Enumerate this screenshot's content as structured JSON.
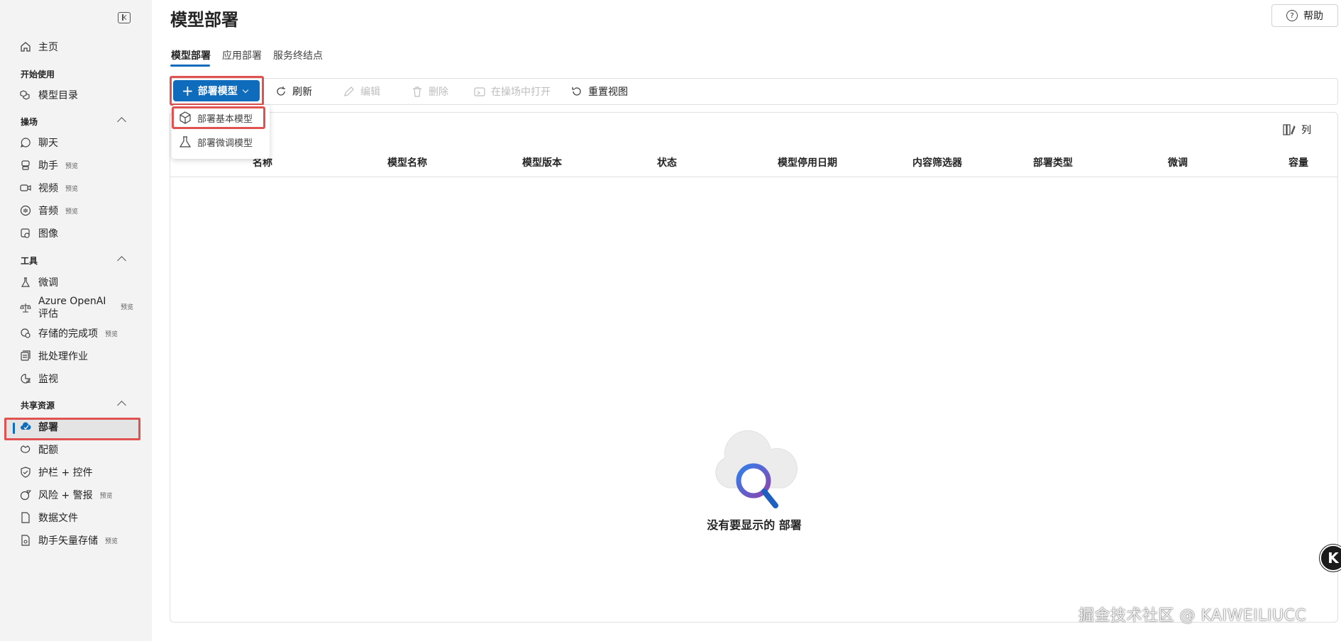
{
  "sidebar": {
    "home": "主页",
    "sections": {
      "get_started": "开始使用",
      "playground": "操场",
      "tools": "工具",
      "shared": "共享资源"
    },
    "items": {
      "model_catalog": "模型目录",
      "chat": "聊天",
      "assistants": "助手",
      "video": "视频",
      "audio": "音频",
      "images": "图像",
      "finetune": "微调",
      "eval": "Azure OpenAI 评估",
      "stored_completions": "存储的完成项",
      "batch": "批处理作业",
      "monitor": "监视",
      "deployments": "部署",
      "quota": "配额",
      "guardrails": "护栏 + 控件",
      "risk": "风险 + 警报",
      "data_files": "数据文件",
      "vector_stores": "助手矢量存储"
    },
    "preview_badge": "预览"
  },
  "header": {
    "title": "模型部署",
    "help": "帮助"
  },
  "tabs": [
    "模型部署",
    "应用部署",
    "服务终结点"
  ],
  "toolbar": {
    "deploy": "部署模型",
    "refresh": "刷新",
    "edit": "编辑",
    "delete": "删除",
    "open_playground": "在操场中打开",
    "reset_view": "重置视图"
  },
  "dropdown": {
    "base_model": "部署基本模型",
    "finetuned_model": "部署微调模型"
  },
  "grid": {
    "columns_button": "列",
    "columns": [
      "名称",
      "模型名称",
      "模型版本",
      "状态",
      "模型停用日期",
      "内容筛选器",
      "部署类型",
      "微调",
      "容量"
    ],
    "empty_text": "没有要显示的 部署"
  },
  "overlay": {
    "float_letter": "K",
    "watermark": "掘金技术社区 @ KAIWEILIUCC"
  }
}
